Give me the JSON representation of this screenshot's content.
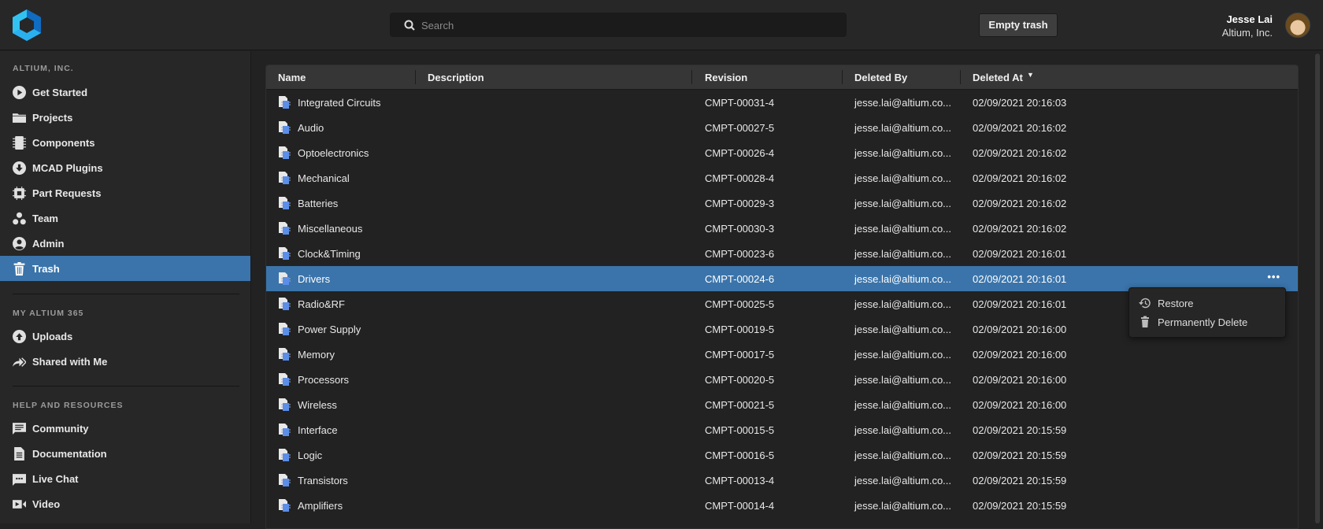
{
  "header": {
    "search_placeholder": "Search",
    "empty_trash": "Empty trash",
    "user_name": "Jesse Lai",
    "user_org": "Altium, Inc."
  },
  "sidebar": {
    "sections": [
      {
        "title": "ALTIUM, INC.",
        "items": [
          {
            "label": "Get Started",
            "icon": "play-circle-icon"
          },
          {
            "label": "Projects",
            "icon": "folder-icon"
          },
          {
            "label": "Components",
            "icon": "chip-icon"
          },
          {
            "label": "MCAD Plugins",
            "icon": "download-circle-icon"
          },
          {
            "label": "Part Requests",
            "icon": "processor-icon"
          },
          {
            "label": "Team",
            "icon": "team-icon"
          },
          {
            "label": "Admin",
            "icon": "user-circle-icon"
          },
          {
            "label": "Trash",
            "icon": "trash-icon",
            "active": true
          }
        ]
      },
      {
        "title": "MY ALTIUM 365",
        "items": [
          {
            "label": "Uploads",
            "icon": "upload-circle-icon"
          },
          {
            "label": "Shared with Me",
            "icon": "share-icon"
          }
        ]
      },
      {
        "title": "HELP AND RESOURCES",
        "items": [
          {
            "label": "Community",
            "icon": "message-icon"
          },
          {
            "label": "Documentation",
            "icon": "document-icon"
          },
          {
            "label": "Live Chat",
            "icon": "chat-icon"
          },
          {
            "label": "Video",
            "icon": "video-icon"
          }
        ]
      }
    ]
  },
  "table": {
    "columns": [
      "Name",
      "Description",
      "Revision",
      "Deleted By",
      "Deleted At"
    ],
    "sort_column": "Deleted At",
    "rows": [
      {
        "name": "Integrated Circuits",
        "description": "",
        "revision": "CMPT-00031-4",
        "deleted_by": "jesse.lai@altium.co...",
        "deleted_at": "02/09/2021 20:16:03"
      },
      {
        "name": "Audio",
        "description": "",
        "revision": "CMPT-00027-5",
        "deleted_by": "jesse.lai@altium.co...",
        "deleted_at": "02/09/2021 20:16:02"
      },
      {
        "name": "Optoelectronics",
        "description": "",
        "revision": "CMPT-00026-4",
        "deleted_by": "jesse.lai@altium.co...",
        "deleted_at": "02/09/2021 20:16:02"
      },
      {
        "name": "Mechanical",
        "description": "",
        "revision": "CMPT-00028-4",
        "deleted_by": "jesse.lai@altium.co...",
        "deleted_at": "02/09/2021 20:16:02"
      },
      {
        "name": "Batteries",
        "description": "",
        "revision": "CMPT-00029-3",
        "deleted_by": "jesse.lai@altium.co...",
        "deleted_at": "02/09/2021 20:16:02"
      },
      {
        "name": "Miscellaneous",
        "description": "",
        "revision": "CMPT-00030-3",
        "deleted_by": "jesse.lai@altium.co...",
        "deleted_at": "02/09/2021 20:16:02"
      },
      {
        "name": "Clock&Timing",
        "description": "",
        "revision": "CMPT-00023-6",
        "deleted_by": "jesse.lai@altium.co...",
        "deleted_at": "02/09/2021 20:16:01"
      },
      {
        "name": "Drivers",
        "description": "",
        "revision": "CMPT-00024-6",
        "deleted_by": "jesse.lai@altium.co...",
        "deleted_at": "02/09/2021 20:16:01",
        "selected": true
      },
      {
        "name": "Radio&RF",
        "description": "",
        "revision": "CMPT-00025-5",
        "deleted_by": "jesse.lai@altium.co...",
        "deleted_at": "02/09/2021 20:16:01"
      },
      {
        "name": "Power Supply",
        "description": "",
        "revision": "CMPT-00019-5",
        "deleted_by": "jesse.lai@altium.co...",
        "deleted_at": "02/09/2021 20:16:00"
      },
      {
        "name": "Memory",
        "description": "",
        "revision": "CMPT-00017-5",
        "deleted_by": "jesse.lai@altium.co...",
        "deleted_at": "02/09/2021 20:16:00"
      },
      {
        "name": "Processors",
        "description": "",
        "revision": "CMPT-00020-5",
        "deleted_by": "jesse.lai@altium.co...",
        "deleted_at": "02/09/2021 20:16:00"
      },
      {
        "name": "Wireless",
        "description": "",
        "revision": "CMPT-00021-5",
        "deleted_by": "jesse.lai@altium.co...",
        "deleted_at": "02/09/2021 20:16:00"
      },
      {
        "name": "Interface",
        "description": "",
        "revision": "CMPT-00015-5",
        "deleted_by": "jesse.lai@altium.co...",
        "deleted_at": "02/09/2021 20:15:59"
      },
      {
        "name": "Logic",
        "description": "",
        "revision": "CMPT-00016-5",
        "deleted_by": "jesse.lai@altium.co...",
        "deleted_at": "02/09/2021 20:15:59"
      },
      {
        "name": "Transistors",
        "description": "",
        "revision": "CMPT-00013-4",
        "deleted_by": "jesse.lai@altium.co...",
        "deleted_at": "02/09/2021 20:15:59"
      },
      {
        "name": "Amplifiers",
        "description": "",
        "revision": "CMPT-00014-4",
        "deleted_by": "jesse.lai@altium.co...",
        "deleted_at": "02/09/2021 20:15:59"
      }
    ]
  },
  "context_menu": {
    "items": [
      {
        "label": "Restore",
        "icon": "restore-icon"
      },
      {
        "label": "Permanently Delete",
        "icon": "trash-icon"
      }
    ]
  },
  "colors": {
    "accent": "#3b74aa",
    "background": "#222222",
    "sidebar": "#272727"
  }
}
